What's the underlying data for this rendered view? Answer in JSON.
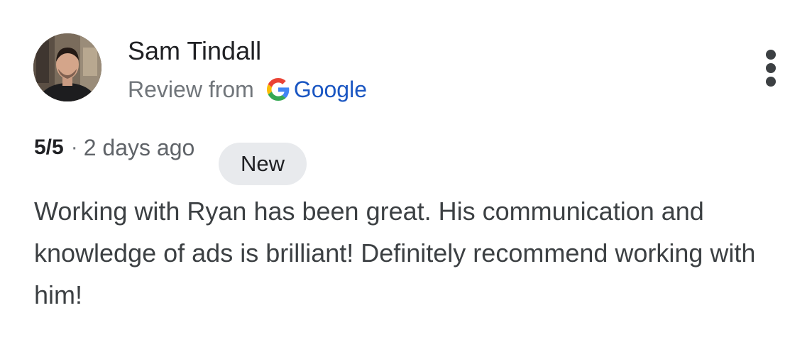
{
  "review": {
    "author_name": "Sam Tindall",
    "source_prefix": "Review from",
    "source_name": "Google",
    "rating": "5/5",
    "separator": "·",
    "time_ago": "2 days ago",
    "badge": "New",
    "text": "Working with Ryan has been great. His communication and knowledge of ads is brilliant! Definitely recommend working with him!"
  },
  "icons": {
    "avatar": "profile-photo",
    "source_logo": "google-g-icon",
    "more": "more-vert-icon"
  },
  "colors": {
    "link_blue": "#1a56c2",
    "muted_text": "#70757a",
    "badge_bg": "#e8eaed",
    "google_blue": "#4285F4",
    "google_red": "#EA4335",
    "google_yellow": "#FBBC05",
    "google_green": "#34A853"
  }
}
